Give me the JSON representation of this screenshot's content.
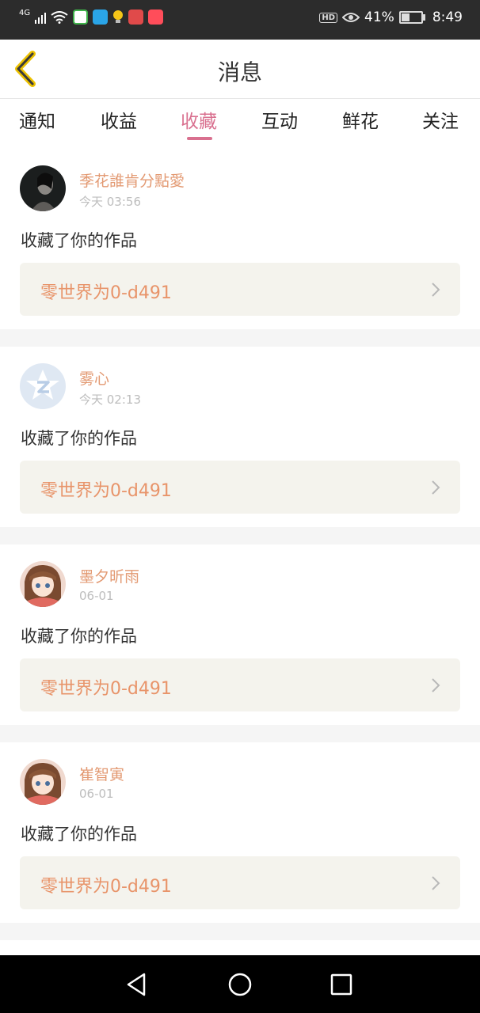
{
  "status_bar": {
    "network": "4G",
    "hd": "HD",
    "battery": "41%",
    "battery_fraction": 0.41,
    "time": "8:49"
  },
  "header": {
    "title": "消息",
    "back_icon": "back-arrow-icon"
  },
  "tabs": [
    {
      "label": "通知",
      "active": false
    },
    {
      "label": "收益",
      "active": false
    },
    {
      "label": "收藏",
      "active": true
    },
    {
      "label": "互动",
      "active": false
    },
    {
      "label": "鲜花",
      "active": false
    },
    {
      "label": "关注",
      "active": false
    }
  ],
  "notifications": [
    {
      "user": "季花誰肯分點愛",
      "time": "今天 03:56",
      "action": "收藏了你的作品",
      "work": "零世界为0-d491"
    },
    {
      "user": "雾心",
      "time": "今天 02:13",
      "action": "收藏了你的作品",
      "work": "零世界为0-d491"
    },
    {
      "user": "墨夕昕雨",
      "time": "06-01",
      "action": "收藏了你的作品",
      "work": "零世界为0-d491"
    },
    {
      "user": "崔智寅",
      "time": "06-01",
      "action": "收藏了你的作品",
      "work": "零世界为0-d491"
    }
  ],
  "colors": {
    "accent": "#d9708f",
    "username": "#e39a73",
    "work_title": "#e8946a",
    "work_bg": "#f4f3ed"
  }
}
